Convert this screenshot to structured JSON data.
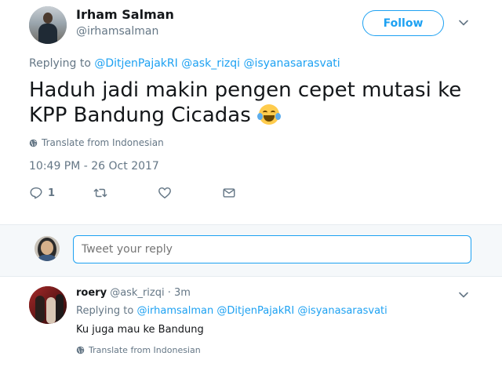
{
  "tweet": {
    "author_name": "Irham Salman",
    "author_handle": "@irhamsalman",
    "follow_label": "Follow",
    "replying_prefix": "Replying to",
    "replying_to": [
      "@DitjenPajakRI",
      "@ask_rizqi",
      "@isyanasarasvati"
    ],
    "text": "Haduh jadi makin pengen cepet mutasi ke KPP Bandung Cicadas",
    "translate_label": "Translate from Indonesian",
    "timestamp": "10:49 PM - 26 Oct 2017",
    "reply_count": "1"
  },
  "reply_box": {
    "placeholder": "Tweet your reply"
  },
  "reply": {
    "author_name": "roery",
    "author_handle": "@ask_rizqi",
    "separator": "·",
    "time": "3m",
    "replying_prefix": "Replying to",
    "replying_to": [
      "@irhamsalman",
      "@DitjenPajakRI",
      "@isyanasarasvati"
    ],
    "text": "Ku juga mau ke Bandung",
    "translate_label": "Translate from Indonesian"
  },
  "colors": {
    "accent": "#1da1f2",
    "muted": "#657786",
    "text": "#14171a",
    "reply_bar_bg": "#f5f8fa"
  },
  "icons": [
    "globe-icon",
    "reply-icon",
    "retweet-icon",
    "like-icon",
    "direct-message-icon",
    "chevron-down-icon"
  ]
}
